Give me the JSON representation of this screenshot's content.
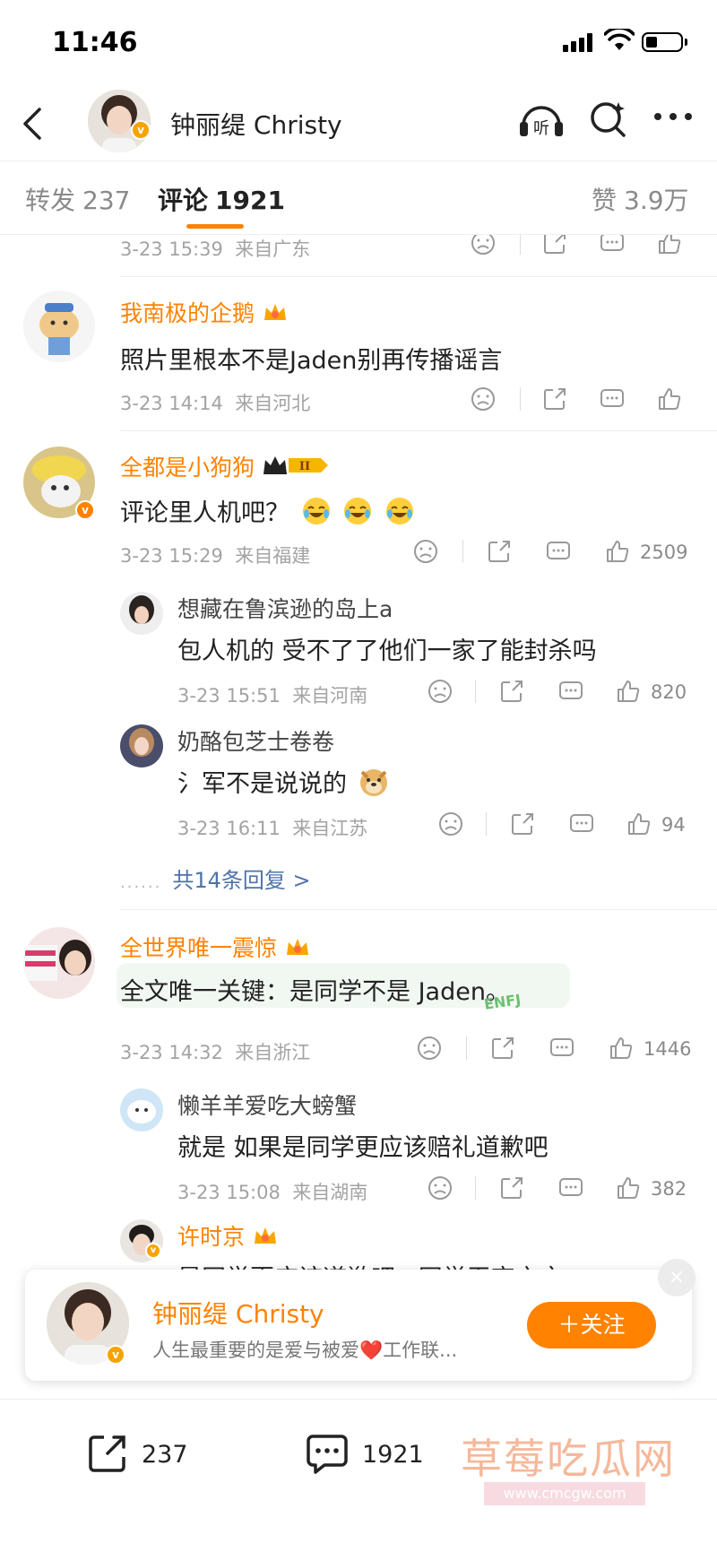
{
  "status": {
    "time": "11:46"
  },
  "header": {
    "name": "钟丽缇 Christy",
    "listen_label": "听"
  },
  "tabs": {
    "repost_label": "转发",
    "repost_count": "237",
    "comment_label": "评论",
    "comment_count": "1921",
    "like_label": "赞",
    "like_count": "3.9万"
  },
  "comments": [
    {
      "time": "3-23 15:39",
      "location": "来自广东"
    },
    {
      "name": "我南极的企鹅",
      "text": "照片里根本不是Jaden别再传播谣言",
      "time": "3-23 14:14",
      "location": "来自河北"
    },
    {
      "name": "全都是小狗狗",
      "badge": "II",
      "text": "评论里人机吧？",
      "time": "3-23 15:29",
      "location": "来自福建",
      "likes": "2509",
      "replies": [
        {
          "name": "想藏在鲁滨逊的岛上a",
          "text": "包人机的 受不了了他们一家了能封杀吗",
          "time": "3-23 15:51",
          "location": "来自河南",
          "likes": "820"
        },
        {
          "name": "奶酪包芝士卷卷",
          "text": "氵军不是说说的",
          "time": "3-23 16:11",
          "location": "来自江苏",
          "likes": "94"
        }
      ],
      "more_replies": "共14条回复 >"
    },
    {
      "name": "全世界唯一震惊",
      "text": "全文唯一关键：是同学不是 Jaden。",
      "sticker": "ENFJ",
      "time": "3-23 14:32",
      "location": "来自浙江",
      "likes": "1446",
      "replies": [
        {
          "name": "懒羊羊爱吃大螃蟹",
          "text": "就是 如果是同学更应该赔礼道歉吧",
          "time": "3-23 15:08",
          "location": "来自湖南",
          "likes": "382"
        },
        {
          "name": "许时京",
          "text": "是同学更应该道歉吧...同学无妄之灾"
        }
      ]
    }
  ],
  "follow_card": {
    "name": "钟丽缇 Christy",
    "bio": "人生最重要的是爱与被爱❤️工作联...",
    "follow_label": "＋关注",
    "close": "×"
  },
  "bottom_bar": {
    "repost_count": "237",
    "comment_count": "1921"
  },
  "watermark": {
    "text": "草莓吃瓜网",
    "url": "www.cmcgw.com"
  },
  "colors": {
    "accent": "#ff8200",
    "link": "#4f73a8",
    "meta": "#a3a3a3"
  }
}
